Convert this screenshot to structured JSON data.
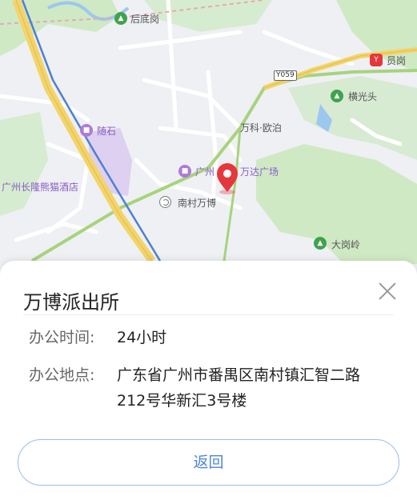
{
  "map": {
    "labels": {
      "houdigang": "后底岗",
      "yungang": "员岗",
      "hengguangtou": "横光头",
      "suishi": "随石",
      "wanke_oubo": "万科·欧泊",
      "hotel": "广州长隆熊猫酒店",
      "guangzhou_partial": "广州",
      "wanda_plaza": "万达广场",
      "nancun_wanbo": "南村万博",
      "dagangling": "大岗岭",
      "road_badge": "Y059"
    },
    "icons": {
      "houdigang": "mountain-icon",
      "yungang": "metro-station-icon",
      "hengguangtou": "mountain-icon",
      "suishi": "shop-icon",
      "guangzhou_partial": "mall-icon",
      "dagangling": "mountain-icon",
      "nancun_wanbo": "metro-icon",
      "selected": "location-pin-icon"
    },
    "colors": {
      "pin": "#e5373e",
      "poi_green": "#3fa34d",
      "poi_purple": "#b07ad9",
      "expressway": "#f3d46a",
      "metro_line": "#4f7fd6",
      "green_road": "#a7d37c"
    }
  },
  "info": {
    "title": "万博派出所",
    "hours_label": "办公时间:",
    "hours_value": "24小时",
    "address_label": "办公地点:",
    "address_value": "广东省广州市番禺区南村镇汇智二路212号华新汇3号楼",
    "back_label": "返回"
  }
}
